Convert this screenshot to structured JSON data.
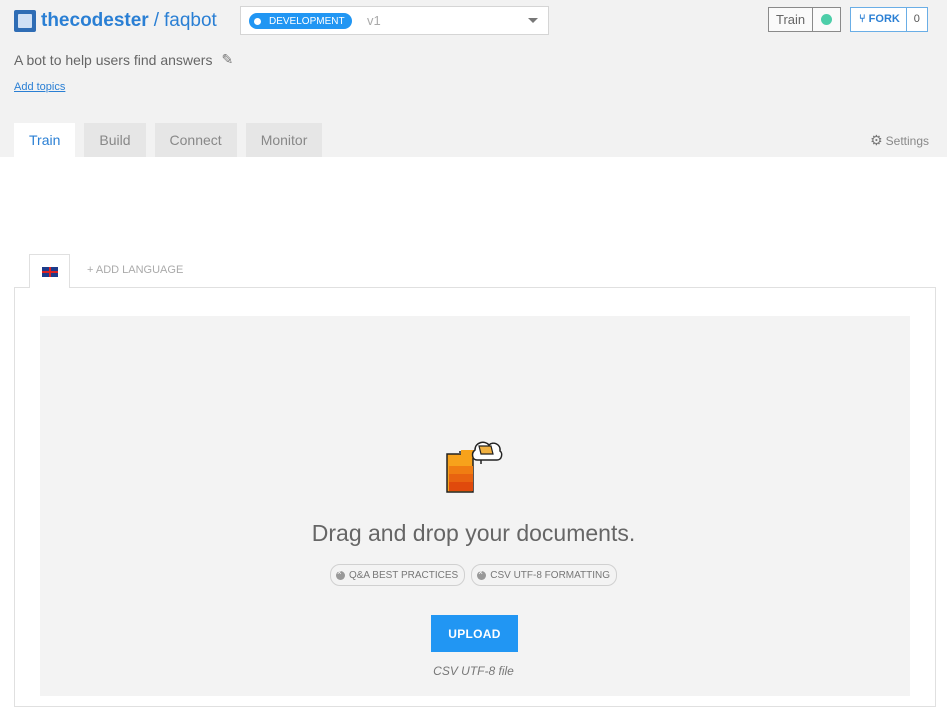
{
  "header": {
    "owner": "thecodester",
    "separator": "/",
    "repo": "faqbot",
    "description": "A bot to help users find answers",
    "add_topics": "Add topics"
  },
  "version": {
    "environment": "DEVELOPMENT",
    "version": "v1"
  },
  "train_status": {
    "label": "Train",
    "status_color": "#4dcea9"
  },
  "fork": {
    "label": "FORK",
    "count": "0"
  },
  "tabs": [
    {
      "label": "Train",
      "active": true
    },
    {
      "label": "Build",
      "active": false
    },
    {
      "label": "Connect",
      "active": false
    },
    {
      "label": "Monitor",
      "active": false
    }
  ],
  "settings_label": "Settings",
  "language": {
    "current_flag": "uk-flag-icon",
    "add_label": "+ ADD LANGUAGE"
  },
  "dropzone": {
    "title": "Drag and drop your documents.",
    "chips": [
      "Q&A BEST PRACTICES",
      "CSV UTF-8 FORMATTING"
    ],
    "upload_label": "UPLOAD",
    "hint": "CSV UTF-8 file"
  },
  "colors": {
    "accent": "#2196f3",
    "link": "#2a7fd4",
    "status_ok": "#4dcea9"
  }
}
